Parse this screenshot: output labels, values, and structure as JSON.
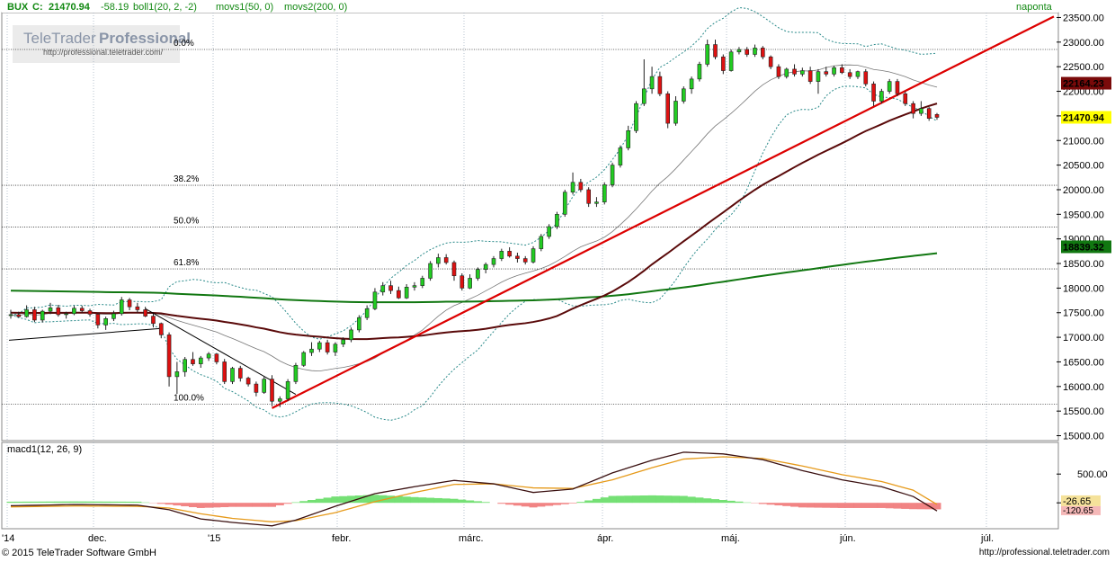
{
  "header": {
    "symbol": "BUX",
    "close_label": "C:",
    "close": "21470.94",
    "change": "-58.19",
    "indicators": [
      "boll1(20, 2, -2)",
      "movs1(50, 0)",
      "movs2(200, 0)"
    ],
    "period": "naponta"
  },
  "watermark": {
    "title_left": "TeleTrader",
    "title_right": "Professional",
    "url": "http://professional.teletrader.com/"
  },
  "footer": {
    "copyright": "© 2015 TeleTrader Software GmbH",
    "url": "http://professional.teletrader.com"
  },
  "colors": {
    "up": "#22cc22",
    "down": "#dd1111",
    "trendline": "#dd0000",
    "sma50": "#5a0a0a",
    "sma200": "#117711",
    "bollinger": "#2a8a8a",
    "macd_line": "#3a1010",
    "signal_line": "#e69a1a"
  },
  "chart_data": [
    {
      "type": "candlestick",
      "title": "BUX",
      "y_ticks": [
        "15000.00",
        "15500.00",
        "16000.00",
        "16500.00",
        "17000.00",
        "17500.00",
        "18000.00",
        "18500.00",
        "19000.00",
        "19500.00",
        "20000.00",
        "20500.00",
        "21000.00",
        "21500.00",
        "22000.00",
        "22500.00",
        "23000.00",
        "23500.00"
      ],
      "ylim": [
        14900,
        23600
      ],
      "x_labels": [
        "'14",
        "dec.",
        "'15",
        "febr.",
        "márc.",
        "ápr.",
        "máj.",
        "jún.",
        "júl."
      ],
      "fibonacci": [
        {
          "label": "0.0%",
          "value": 22850
        },
        {
          "label": "38.2%",
          "value": 20090
        },
        {
          "label": "50.0%",
          "value": 19240
        },
        {
          "label": "61.8%",
          "value": 18390
        },
        {
          "label": "100.0%",
          "value": 15640
        }
      ],
      "badges": [
        {
          "label": "22164.23",
          "value": 22164.23,
          "series": "movs1(50, 0)"
        },
        {
          "label": "21470.94",
          "value": 21470.94,
          "series": "BUX"
        },
        {
          "label": "18839.32",
          "value": 18839.32,
          "series": "movs2(200, 0)"
        }
      ],
      "candles": [
        [
          17440,
          17560,
          17380,
          17460
        ],
        [
          17460,
          17520,
          17400,
          17420
        ],
        [
          17420,
          17650,
          17400,
          17560
        ],
        [
          17560,
          17620,
          17310,
          17350
        ],
        [
          17350,
          17560,
          17300,
          17530
        ],
        [
          17530,
          17700,
          17470,
          17600
        ],
        [
          17600,
          17660,
          17420,
          17460
        ],
        [
          17460,
          17520,
          17380,
          17480
        ],
        [
          17480,
          17640,
          17450,
          17590
        ],
        [
          17590,
          17640,
          17500,
          17540
        ],
        [
          17540,
          17580,
          17420,
          17470
        ],
        [
          17470,
          17500,
          17180,
          17250
        ],
        [
          17250,
          17420,
          17150,
          17380
        ],
        [
          17380,
          17540,
          17330,
          17480
        ],
        [
          17480,
          17820,
          17440,
          17760
        ],
        [
          17760,
          17800,
          17550,
          17620
        ],
        [
          17620,
          17700,
          17500,
          17560
        ],
        [
          17560,
          17620,
          17410,
          17430
        ],
        [
          17430,
          17480,
          17200,
          17280
        ],
        [
          17280,
          17300,
          16980,
          17050
        ],
        [
          17050,
          17100,
          16000,
          16200
        ],
        [
          16200,
          16500,
          15850,
          16300
        ],
        [
          16300,
          16600,
          16200,
          16550
        ],
        [
          16550,
          16700,
          16420,
          16460
        ],
        [
          16460,
          16620,
          16380,
          16580
        ],
        [
          16580,
          16700,
          16520,
          16660
        ],
        [
          16660,
          16680,
          16450,
          16500
        ],
        [
          16500,
          16560,
          16050,
          16100
        ],
        [
          16100,
          16400,
          16050,
          16370
        ],
        [
          16370,
          16420,
          16100,
          16170
        ],
        [
          16170,
          16200,
          16000,
          16050
        ],
        [
          16050,
          16100,
          15800,
          15880
        ],
        [
          15880,
          16200,
          15850,
          16150
        ],
        [
          16150,
          16230,
          15600,
          15700
        ],
        [
          15700,
          15800,
          15580,
          15750
        ],
        [
          15750,
          16150,
          15700,
          16100
        ],
        [
          16100,
          16480,
          16050,
          16430
        ],
        [
          16430,
          16720,
          16400,
          16690
        ],
        [
          16690,
          16900,
          16620,
          16760
        ],
        [
          16760,
          16930,
          16700,
          16890
        ],
        [
          16890,
          16950,
          16650,
          16700
        ],
        [
          16700,
          16900,
          16620,
          16860
        ],
        [
          16860,
          17000,
          16800,
          16950
        ],
        [
          16950,
          17200,
          16900,
          17150
        ],
        [
          17150,
          17450,
          17100,
          17400
        ],
        [
          17400,
          17650,
          17350,
          17580
        ],
        [
          17580,
          18000,
          17550,
          17920
        ],
        [
          17920,
          18120,
          17850,
          18050
        ],
        [
          18050,
          18150,
          17880,
          17950
        ],
        [
          17950,
          18030,
          17780,
          17800
        ],
        [
          17800,
          18080,
          17780,
          18020
        ],
        [
          18020,
          18120,
          17950,
          18050
        ],
        [
          18050,
          18250,
          18000,
          18200
        ],
        [
          18200,
          18550,
          18150,
          18500
        ],
        [
          18500,
          18700,
          18420,
          18620
        ],
        [
          18620,
          18690,
          18480,
          18520
        ],
        [
          18520,
          18560,
          18150,
          18250
        ],
        [
          18250,
          18300,
          17950,
          18000
        ],
        [
          18000,
          18280,
          17980,
          18200
        ],
        [
          18200,
          18420,
          18150,
          18380
        ],
        [
          18380,
          18520,
          18300,
          18480
        ],
        [
          18480,
          18650,
          18420,
          18600
        ],
        [
          18600,
          18800,
          18550,
          18750
        ],
        [
          18750,
          18830,
          18620,
          18650
        ],
        [
          18650,
          18720,
          18520,
          18600
        ],
        [
          18600,
          18650,
          18480,
          18530
        ],
        [
          18530,
          18850,
          18500,
          18800
        ],
        [
          18800,
          19100,
          18750,
          19050
        ],
        [
          19050,
          19300,
          19000,
          19250
        ],
        [
          19250,
          19550,
          19200,
          19500
        ],
        [
          19500,
          20000,
          19450,
          19950
        ],
        [
          19950,
          20350,
          19900,
          20150
        ],
        [
          20150,
          20220,
          19950,
          20000
        ],
        [
          20000,
          20050,
          19650,
          19720
        ],
        [
          19720,
          19850,
          19650,
          19750
        ],
        [
          19750,
          20150,
          19700,
          20100
        ],
        [
          20100,
          20550,
          20050,
          20500
        ],
        [
          20500,
          20900,
          20450,
          20850
        ],
        [
          20850,
          21300,
          20800,
          21200
        ],
        [
          21200,
          21800,
          21150,
          21750
        ],
        [
          21750,
          22650,
          21700,
          22050
        ],
        [
          22050,
          22500,
          21950,
          22300
        ],
        [
          22300,
          22400,
          21900,
          21950
        ],
        [
          21950,
          22000,
          21250,
          21350
        ],
        [
          21350,
          21900,
          21300,
          21800
        ],
        [
          21800,
          22100,
          21750,
          22050
        ],
        [
          22050,
          22300,
          21950,
          22250
        ],
        [
          22250,
          22600,
          22200,
          22550
        ],
        [
          22550,
          23050,
          22500,
          22950
        ],
        [
          22950,
          23050,
          22650,
          22700
        ],
        [
          22700,
          22750,
          22350,
          22420
        ],
        [
          22420,
          22850,
          22400,
          22800
        ],
        [
          22800,
          22900,
          22750,
          22850
        ],
        [
          22850,
          22900,
          22700,
          22750
        ],
        [
          22750,
          22950,
          22700,
          22880
        ],
        [
          22880,
          22920,
          22650,
          22700
        ],
        [
          22700,
          22730,
          22450,
          22500
        ],
        [
          22500,
          22550,
          22250,
          22300
        ],
        [
          22300,
          22480,
          22260,
          22450
        ],
        [
          22450,
          22550,
          22300,
          22350
        ],
        [
          22350,
          22480,
          22300,
          22420
        ],
        [
          22420,
          22500,
          22150,
          22200
        ],
        [
          22200,
          22450,
          21950,
          22400
        ],
        [
          22400,
          22500,
          22300,
          22350
        ],
        [
          22350,
          22520,
          22300,
          22480
        ],
        [
          22480,
          22550,
          22350,
          22380
        ],
        [
          22380,
          22450,
          22250,
          22300
        ],
        [
          22300,
          22420,
          22250,
          22400
        ],
        [
          22400,
          22450,
          22100,
          22150
        ],
        [
          22150,
          22200,
          21700,
          21800
        ],
        [
          21800,
          22050,
          21750,
          22000
        ],
        [
          22000,
          22250,
          21950,
          22200
        ],
        [
          22200,
          22250,
          21900,
          21950
        ],
        [
          21950,
          22000,
          21700,
          21750
        ],
        [
          21750,
          21800,
          21450,
          21550
        ],
        [
          21550,
          21800,
          21500,
          21650
        ],
        [
          21650,
          21680,
          21400,
          21450
        ],
        [
          21529,
          21560,
          21420,
          21470.94
        ]
      ]
    },
    {
      "type": "line",
      "title": "macd1(12, 26, 9)",
      "y_ticks": [
        "500.00",
        "0"
      ],
      "ylim": [
        -450,
        1050
      ],
      "last_labels": [
        "-26.65",
        "-120.65"
      ],
      "macd": [
        [
          0,
          -50
        ],
        [
          8,
          -30
        ],
        [
          16,
          -40
        ],
        [
          20,
          -120
        ],
        [
          24,
          -280
        ],
        [
          28,
          -340
        ],
        [
          33,
          -400
        ],
        [
          36,
          -300
        ],
        [
          41,
          -60
        ],
        [
          46,
          160
        ],
        [
          51,
          280
        ],
        [
          56,
          390
        ],
        [
          61,
          330
        ],
        [
          66,
          180
        ],
        [
          71,
          240
        ],
        [
          76,
          520
        ],
        [
          81,
          740
        ],
        [
          85,
          880
        ],
        [
          90,
          850
        ],
        [
          95,
          750
        ],
        [
          100,
          560
        ],
        [
          105,
          400
        ],
        [
          110,
          280
        ],
        [
          114,
          110
        ],
        [
          117,
          -140
        ]
      ],
      "signal": [
        [
          0,
          -70
        ],
        [
          8,
          -55
        ],
        [
          16,
          -60
        ],
        [
          20,
          -90
        ],
        [
          24,
          -190
        ],
        [
          28,
          -270
        ],
        [
          33,
          -330
        ],
        [
          36,
          -310
        ],
        [
          41,
          -170
        ],
        [
          46,
          20
        ],
        [
          51,
          180
        ],
        [
          56,
          320
        ],
        [
          61,
          330
        ],
        [
          66,
          260
        ],
        [
          71,
          250
        ],
        [
          76,
          400
        ],
        [
          81,
          610
        ],
        [
          85,
          760
        ],
        [
          90,
          800
        ],
        [
          95,
          770
        ],
        [
          100,
          640
        ],
        [
          105,
          490
        ],
        [
          110,
          370
        ],
        [
          114,
          220
        ],
        [
          117,
          -26.65
        ]
      ]
    }
  ]
}
